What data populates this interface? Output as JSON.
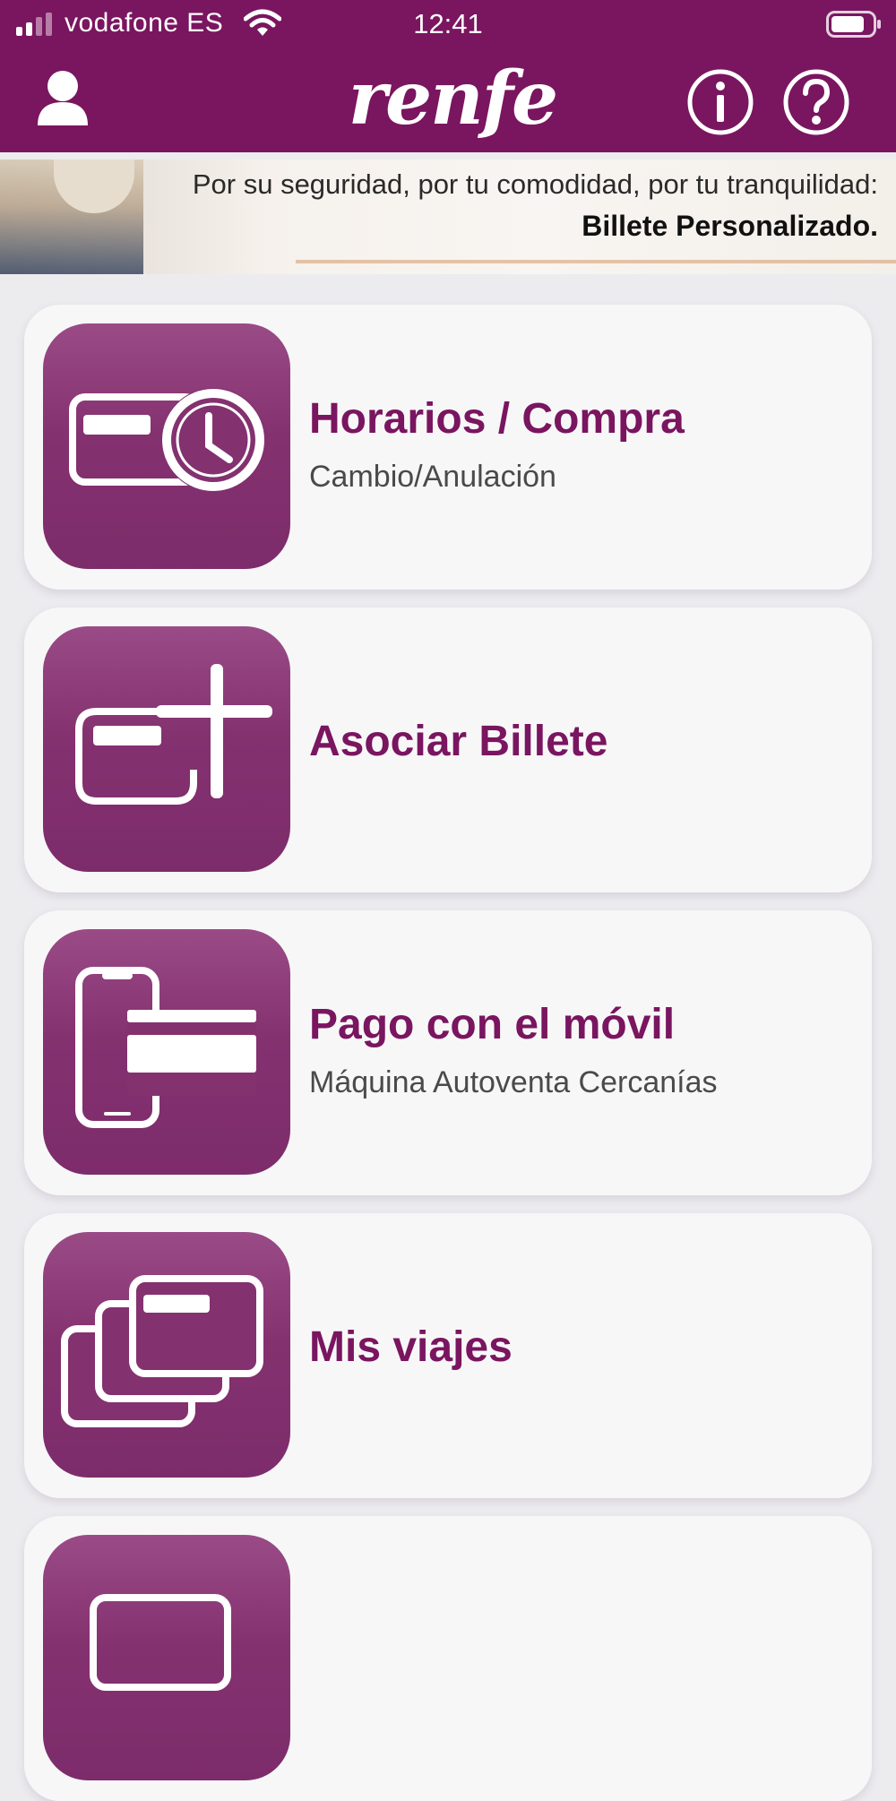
{
  "status_bar": {
    "carrier": "vodafone ES",
    "time": "12:41"
  },
  "header": {
    "logo": "renfe",
    "user_icon": "user-icon",
    "info_icon": "info-icon",
    "help_icon": "help-icon"
  },
  "banner": {
    "line1": "Por su seguridad, por tu comodidad, por tu tranquilidad:",
    "line2": "Billete Personalizado."
  },
  "menu": [
    {
      "title": "Horarios / Compra",
      "subtitle": "Cambio/Anulación",
      "icon": "ticket-clock-icon"
    },
    {
      "title": "Asociar Billete",
      "subtitle": "",
      "icon": "ticket-add-icon"
    },
    {
      "title": "Pago con el móvil",
      "subtitle": "Máquina Autoventa Cercanías",
      "icon": "phone-card-icon"
    },
    {
      "title": "Mis viajes",
      "subtitle": "",
      "icon": "tickets-stack-icon"
    }
  ],
  "colors": {
    "brand": "#7a1560",
    "tile": "#843170",
    "card": "#f7f7f8",
    "background": "#ececef"
  }
}
